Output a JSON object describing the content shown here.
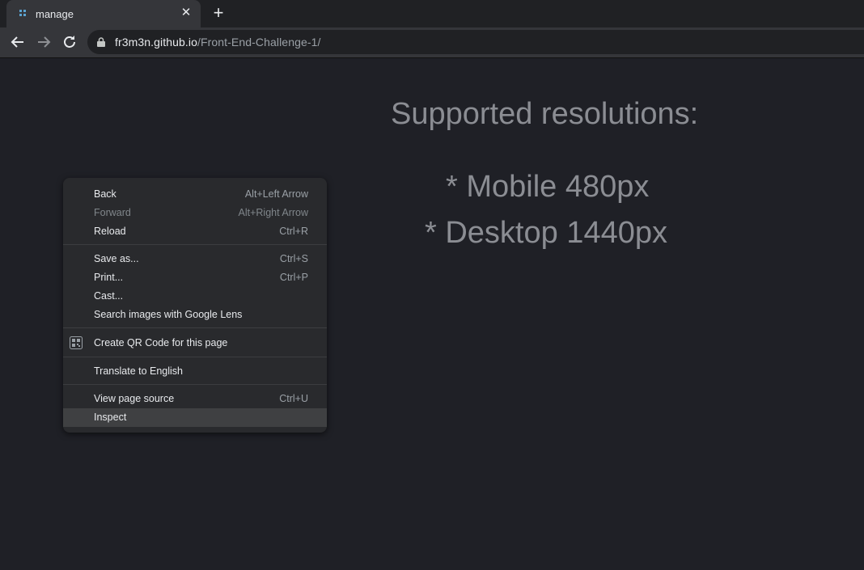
{
  "browser": {
    "tab": {
      "title": "manage"
    },
    "url": {
      "host": "fr3m3n.github.io",
      "path": "/Front-End-Challenge-1/"
    }
  },
  "page": {
    "heading": "Supported resolutions:",
    "resolutions": [
      "* Mobile 480px",
      "* Desktop 1440px"
    ]
  },
  "context_menu": {
    "items": [
      {
        "label": "Back",
        "shortcut": "Alt+Left Arrow"
      },
      {
        "label": "Forward",
        "shortcut": "Alt+Right Arrow",
        "disabled": true
      },
      {
        "label": "Reload",
        "shortcut": "Ctrl+R"
      },
      {
        "label": "Save as...",
        "shortcut": "Ctrl+S"
      },
      {
        "label": "Print...",
        "shortcut": "Ctrl+P"
      },
      {
        "label": "Cast..."
      },
      {
        "label": "Search images with Google Lens"
      },
      {
        "label": "Create QR Code for this page",
        "icon": "qr-code-icon"
      },
      {
        "label": "Translate to English"
      },
      {
        "label": "View page source",
        "shortcut": "Ctrl+U"
      },
      {
        "label": "Inspect",
        "highlighted": true
      }
    ]
  }
}
